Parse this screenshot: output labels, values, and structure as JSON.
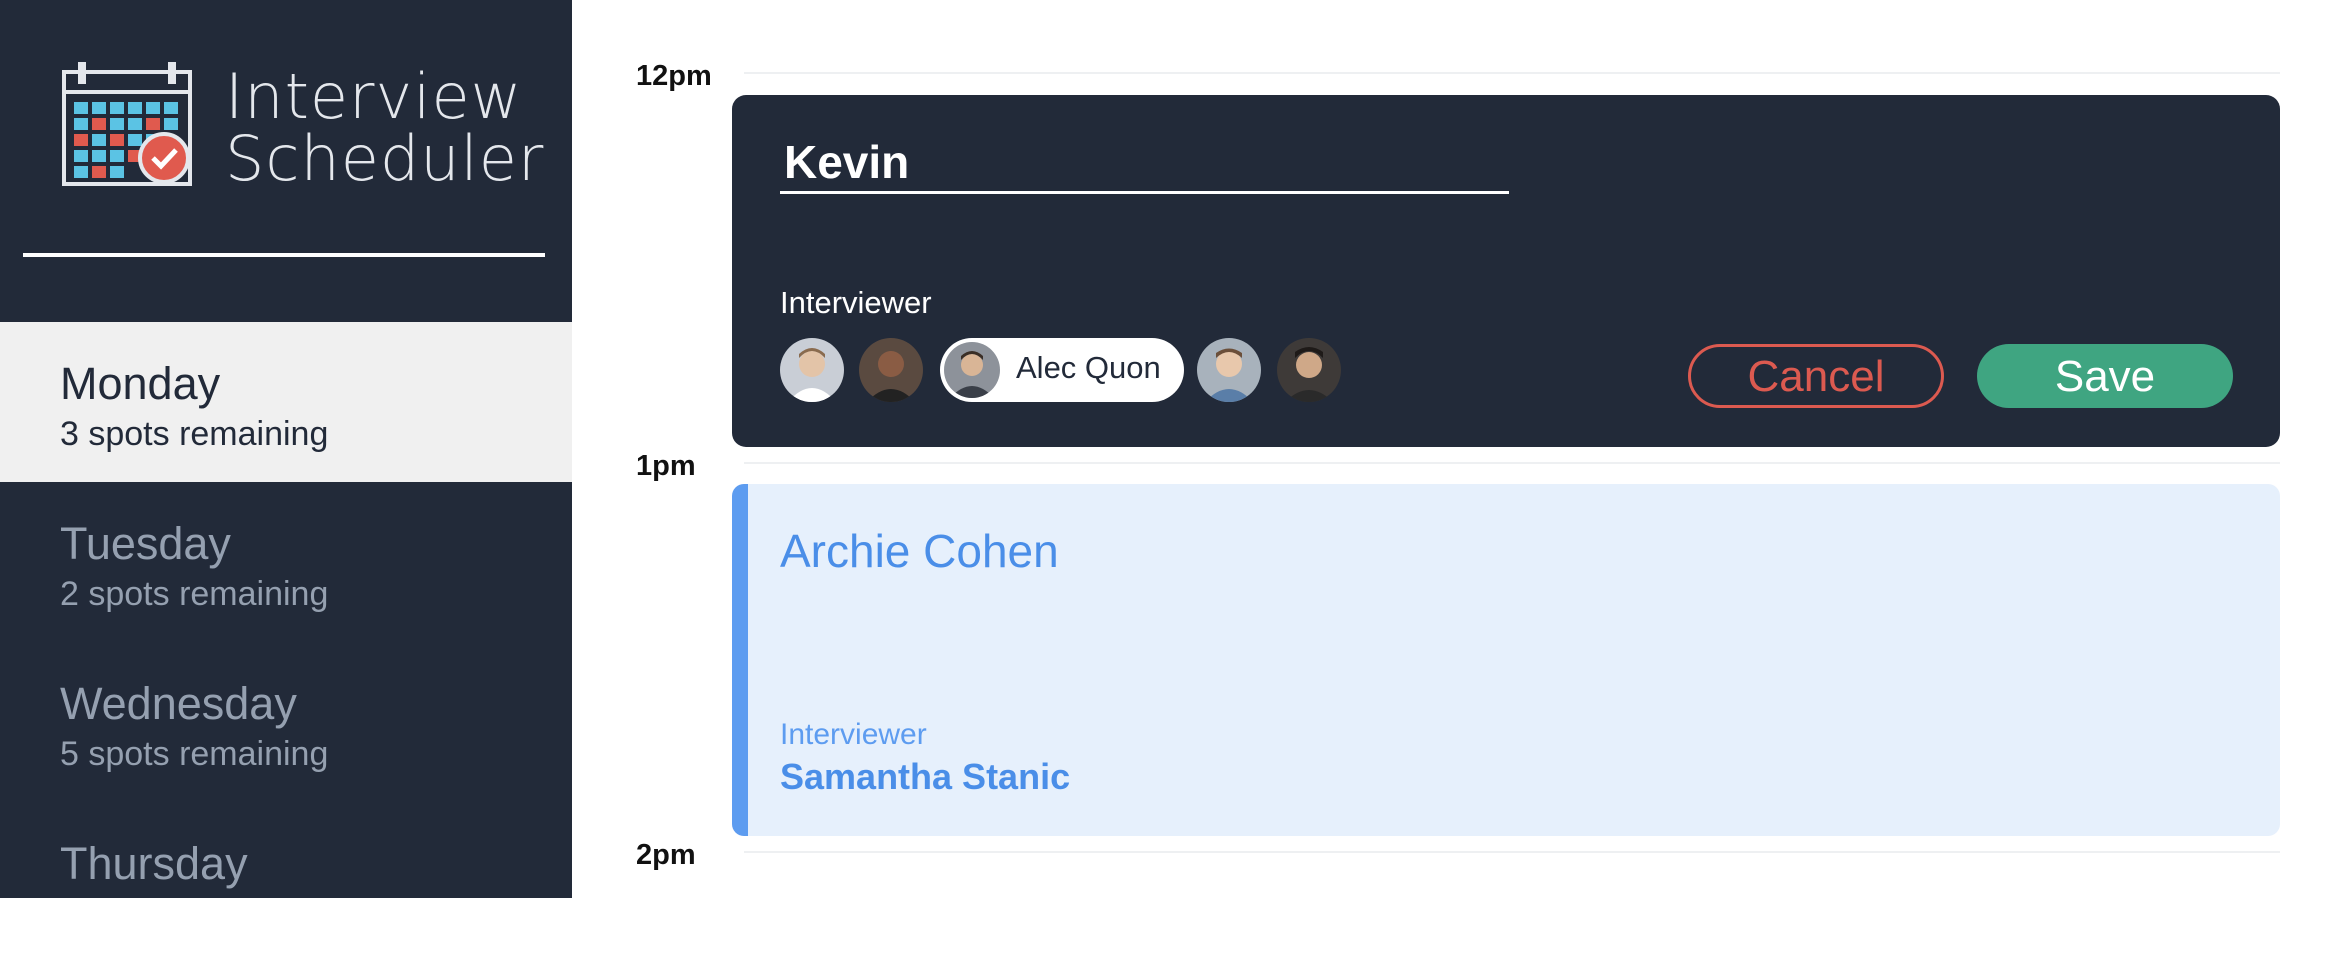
{
  "app": {
    "title_line1": "Interview",
    "title_line2": "Scheduler"
  },
  "sidebar": {
    "days": [
      {
        "name": "Monday",
        "spots": "3 spots remaining",
        "selected": true
      },
      {
        "name": "Tuesday",
        "spots": "2 spots remaining",
        "selected": false
      },
      {
        "name": "Wednesday",
        "spots": "5 spots remaining",
        "selected": false
      },
      {
        "name": "Thursday",
        "spots": "",
        "selected": false
      }
    ]
  },
  "schedule": {
    "times": [
      "12pm",
      "1pm",
      "2pm"
    ]
  },
  "edit_form": {
    "student_name": "Kevin",
    "interviewer_label": "Interviewer",
    "selected_interviewer": "Alec Quon",
    "cancel_label": "Cancel",
    "save_label": "Save"
  },
  "appointment": {
    "student": "Archie Cohen",
    "interviewer_label": "Interviewer",
    "interviewer_name": "Samantha Stanic"
  },
  "colors": {
    "sidebar_bg": "#222a39",
    "cancel": "#dc5a50",
    "save": "#3fa581",
    "appointment_accent": "#5d9cf0"
  }
}
